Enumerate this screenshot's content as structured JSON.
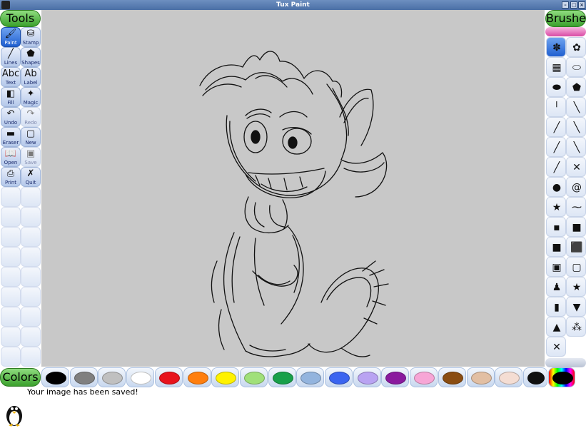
{
  "window": {
    "title": "Tux Paint"
  },
  "tools_header": "Tools",
  "brushes_header": "Brushes",
  "colors_label": "Colors",
  "tools": [
    {
      "label": "Paint",
      "icon": "paintbrush-icon",
      "glyph": "🖌",
      "active": true,
      "disabled": false
    },
    {
      "label": "Stamp",
      "icon": "stamp-icon",
      "glyph": "⛁",
      "active": false,
      "disabled": false
    },
    {
      "label": "Lines",
      "icon": "lines-icon",
      "glyph": "╱",
      "active": false,
      "disabled": false
    },
    {
      "label": "Shapes",
      "icon": "shapes-icon",
      "glyph": "⬟",
      "active": false,
      "disabled": false
    },
    {
      "label": "Text",
      "icon": "text-icon",
      "glyph": "Abc",
      "active": false,
      "disabled": false
    },
    {
      "label": "Label",
      "icon": "label-icon",
      "glyph": "Ab",
      "active": false,
      "disabled": false
    },
    {
      "label": "Fill",
      "icon": "fill-bucket-icon",
      "glyph": "◧",
      "active": false,
      "disabled": false
    },
    {
      "label": "Magic",
      "icon": "magic-wand-icon",
      "glyph": "✦",
      "active": false,
      "disabled": false
    },
    {
      "label": "Undo",
      "icon": "undo-icon",
      "glyph": "↶",
      "active": false,
      "disabled": false
    },
    {
      "label": "Redo",
      "icon": "redo-icon",
      "glyph": "↷",
      "active": false,
      "disabled": true
    },
    {
      "label": "Eraser",
      "icon": "eraser-icon",
      "glyph": "▬",
      "active": false,
      "disabled": false
    },
    {
      "label": "New",
      "icon": "new-document-icon",
      "glyph": "▢",
      "active": false,
      "disabled": false
    },
    {
      "label": "Open",
      "icon": "open-folder-icon",
      "glyph": "📖",
      "active": false,
      "disabled": false
    },
    {
      "label": "Save",
      "icon": "save-icon",
      "glyph": "▣",
      "active": false,
      "disabled": true
    },
    {
      "label": "Print",
      "icon": "printer-icon",
      "glyph": "⎙",
      "active": false,
      "disabled": false
    },
    {
      "label": "Quit",
      "icon": "quit-icon",
      "glyph": "✗",
      "active": false,
      "disabled": false
    }
  ],
  "brushes": [
    {
      "icon": "paw-brush-icon",
      "glyph": "✽",
      "selected": true
    },
    {
      "icon": "cat-brush-icon",
      "glyph": "✿",
      "selected": false
    },
    {
      "icon": "grid-brush-icon",
      "glyph": "▦",
      "selected": false
    },
    {
      "icon": "capsule-brush-icon",
      "glyph": "⬭",
      "selected": false
    },
    {
      "icon": "oval-brush-icon",
      "glyph": "⬬",
      "selected": false
    },
    {
      "icon": "pentagon-brush-icon",
      "glyph": "⬟",
      "selected": false
    },
    {
      "icon": "tick-brush-icon",
      "glyph": "╵",
      "selected": false
    },
    {
      "icon": "slash-brush-icon",
      "glyph": "╲",
      "selected": false
    },
    {
      "icon": "slash2-brush-icon",
      "glyph": "╱",
      "selected": false
    },
    {
      "icon": "backslash-brush-icon",
      "glyph": "╲",
      "selected": false
    },
    {
      "icon": "diagonal-brush-icon",
      "glyph": "╱",
      "selected": false
    },
    {
      "icon": "backslash2-brush-icon",
      "glyph": "╲",
      "selected": false
    },
    {
      "icon": "long-line-brush-icon",
      "glyph": "╱",
      "selected": false
    },
    {
      "icon": "cross-brush-icon",
      "glyph": "✕",
      "selected": false
    },
    {
      "icon": "sphere-brush-icon",
      "glyph": "●",
      "selected": false
    },
    {
      "icon": "spiral-brush-icon",
      "glyph": "@",
      "selected": false
    },
    {
      "icon": "star-brush-icon",
      "glyph": "★",
      "selected": false
    },
    {
      "icon": "dash-brush-icon",
      "glyph": "⁓",
      "selected": false
    },
    {
      "icon": "small-square-brush-icon",
      "glyph": "▪",
      "selected": false
    },
    {
      "icon": "medium-square-brush-icon",
      "glyph": "■",
      "selected": false
    },
    {
      "icon": "square-brush-icon",
      "glyph": "■",
      "selected": false
    },
    {
      "icon": "large-square-brush-icon",
      "glyph": "⬛",
      "selected": false
    },
    {
      "icon": "fuzzy-square-brush-icon",
      "glyph": "▣",
      "selected": false
    },
    {
      "icon": "gray-square-brush-icon",
      "glyph": "▢",
      "selected": false
    },
    {
      "icon": "figure-brush-icon",
      "glyph": "♟",
      "selected": false
    },
    {
      "icon": "big-star-brush-icon",
      "glyph": "★",
      "selected": false
    },
    {
      "icon": "blue-brush-icon",
      "glyph": "▮",
      "selected": false
    },
    {
      "icon": "triangle-down-brush-icon",
      "glyph": "▼",
      "selected": false
    },
    {
      "icon": "triangle-up-brush-icon",
      "glyph": "▲",
      "selected": false
    },
    {
      "icon": "sparkle-brush-icon",
      "glyph": "⁂",
      "selected": false
    },
    {
      "icon": "x-brush-icon",
      "glyph": "✕",
      "selected": false
    }
  ],
  "colors": [
    {
      "name": "black",
      "hex": "#000000",
      "selected": true
    },
    {
      "name": "gray",
      "hex": "#808080",
      "selected": false
    },
    {
      "name": "silver",
      "hex": "#c0c0c0",
      "selected": false
    },
    {
      "name": "white",
      "hex": "#ffffff",
      "selected": false
    },
    {
      "name": "red",
      "hex": "#e8131d",
      "selected": false
    },
    {
      "name": "orange",
      "hex": "#ff7f0f",
      "selected": false
    },
    {
      "name": "yellow",
      "hex": "#fff200",
      "selected": false
    },
    {
      "name": "light-green",
      "hex": "#a0e07a",
      "selected": false
    },
    {
      "name": "green",
      "hex": "#18a04a",
      "selected": false
    },
    {
      "name": "sky-blue",
      "hex": "#93b4de",
      "selected": false
    },
    {
      "name": "blue",
      "hex": "#3a64f0",
      "selected": false
    },
    {
      "name": "lavender",
      "hex": "#b9a3f2",
      "selected": false
    },
    {
      "name": "purple",
      "hex": "#8a1a9e",
      "selected": false
    },
    {
      "name": "pink",
      "hex": "#f7a6d6",
      "selected": false
    },
    {
      "name": "brown",
      "hex": "#8a4d12",
      "selected": false
    },
    {
      "name": "tan",
      "hex": "#e2bfa3",
      "selected": false
    },
    {
      "name": "beige",
      "hex": "#f4ddd3",
      "selected": false
    }
  ],
  "status_message": "Your image has been saved!"
}
